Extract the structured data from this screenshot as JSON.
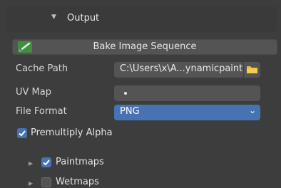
{
  "section": {
    "title": "Output",
    "expanded": true
  },
  "bake": {
    "label": "Bake Image Sequence"
  },
  "cache_path": {
    "label": "Cache Path",
    "value": "C:\\Users\\x\\A...ynamicpaint"
  },
  "uv_map": {
    "label": "UV Map",
    "value": "•"
  },
  "file_format": {
    "label": "File Format",
    "value": "PNG"
  },
  "premultiply": {
    "label": "Premultiply Alpha",
    "checked": true
  },
  "subpanels": [
    {
      "label": "Paintmaps",
      "checked": true
    },
    {
      "label": "Wetmaps",
      "checked": false
    }
  ],
  "colors": {
    "accent": "#4772b3",
    "field": "#545454",
    "background": "#3d3d3d"
  },
  "icons": {
    "bake": "paint-brush-icon",
    "folder": "folder-icon",
    "chevron": "chevron-down-icon",
    "expand": "triangle-right-icon"
  }
}
